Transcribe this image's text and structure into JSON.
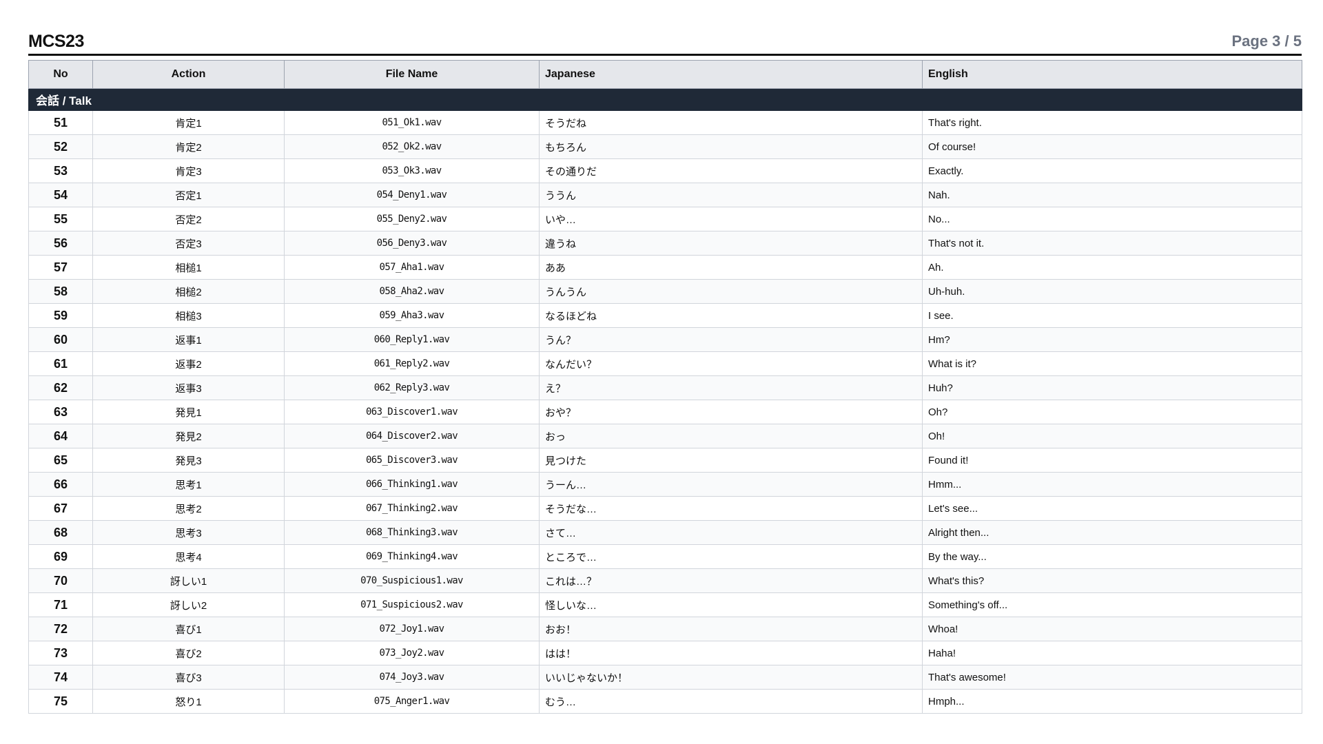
{
  "header": {
    "title": "MCS23",
    "page": "Page 3 / 5"
  },
  "table": {
    "columns": {
      "no": "No",
      "action": "Action",
      "file": "File Name",
      "jp": "Japanese",
      "en": "English"
    },
    "section": "会話 / Talk",
    "rows": [
      {
        "no": "51",
        "action": "肯定1",
        "file": "051_Ok1.wav",
        "jp": "そうだね",
        "en": "That's right."
      },
      {
        "no": "52",
        "action": "肯定2",
        "file": "052_Ok2.wav",
        "jp": "もちろん",
        "en": "Of course!"
      },
      {
        "no": "53",
        "action": "肯定3",
        "file": "053_Ok3.wav",
        "jp": "その通りだ",
        "en": "Exactly."
      },
      {
        "no": "54",
        "action": "否定1",
        "file": "054_Deny1.wav",
        "jp": "ううん",
        "en": "Nah."
      },
      {
        "no": "55",
        "action": "否定2",
        "file": "055_Deny2.wav",
        "jp": "いや…",
        "en": "No..."
      },
      {
        "no": "56",
        "action": "否定3",
        "file": "056_Deny3.wav",
        "jp": "違うね",
        "en": "That's not it."
      },
      {
        "no": "57",
        "action": "相槌1",
        "file": "057_Aha1.wav",
        "jp": "ああ",
        "en": "Ah."
      },
      {
        "no": "58",
        "action": "相槌2",
        "file": "058_Aha2.wav",
        "jp": "うんうん",
        "en": "Uh-huh."
      },
      {
        "no": "59",
        "action": "相槌3",
        "file": "059_Aha3.wav",
        "jp": "なるほどね",
        "en": "I see."
      },
      {
        "no": "60",
        "action": "返事1",
        "file": "060_Reply1.wav",
        "jp": "うん？",
        "en": "Hm?"
      },
      {
        "no": "61",
        "action": "返事2",
        "file": "061_Reply2.wav",
        "jp": "なんだい？",
        "en": "What is it?"
      },
      {
        "no": "62",
        "action": "返事3",
        "file": "062_Reply3.wav",
        "jp": "え？",
        "en": "Huh?"
      },
      {
        "no": "63",
        "action": "発見1",
        "file": "063_Discover1.wav",
        "jp": "おや？",
        "en": "Oh?"
      },
      {
        "no": "64",
        "action": "発見2",
        "file": "064_Discover2.wav",
        "jp": "おっ",
        "en": "Oh!"
      },
      {
        "no": "65",
        "action": "発見3",
        "file": "065_Discover3.wav",
        "jp": "見つけた",
        "en": "Found it!"
      },
      {
        "no": "66",
        "action": "思考1",
        "file": "066_Thinking1.wav",
        "jp": "うーん…",
        "en": "Hmm..."
      },
      {
        "no": "67",
        "action": "思考2",
        "file": "067_Thinking2.wav",
        "jp": "そうだな…",
        "en": "Let's see..."
      },
      {
        "no": "68",
        "action": "思考3",
        "file": "068_Thinking3.wav",
        "jp": "さて…",
        "en": "Alright then..."
      },
      {
        "no": "69",
        "action": "思考4",
        "file": "069_Thinking4.wav",
        "jp": "ところで…",
        "en": "By the way..."
      },
      {
        "no": "70",
        "action": "訝しい1",
        "file": "070_Suspicious1.wav",
        "jp": "これは…？",
        "en": "What's this?"
      },
      {
        "no": "71",
        "action": "訝しい2",
        "file": "071_Suspicious2.wav",
        "jp": "怪しいな…",
        "en": "Something's off..."
      },
      {
        "no": "72",
        "action": "喜び1",
        "file": "072_Joy1.wav",
        "jp": "おお！",
        "en": "Whoa!"
      },
      {
        "no": "73",
        "action": "喜び2",
        "file": "073_Joy2.wav",
        "jp": "はは！",
        "en": "Haha!"
      },
      {
        "no": "74",
        "action": "喜び3",
        "file": "074_Joy3.wav",
        "jp": "いいじゃないか！",
        "en": "That's awesome!"
      },
      {
        "no": "75",
        "action": "怒り1",
        "file": "075_Anger1.wav",
        "jp": "むう…",
        "en": "Hmph..."
      }
    ]
  }
}
